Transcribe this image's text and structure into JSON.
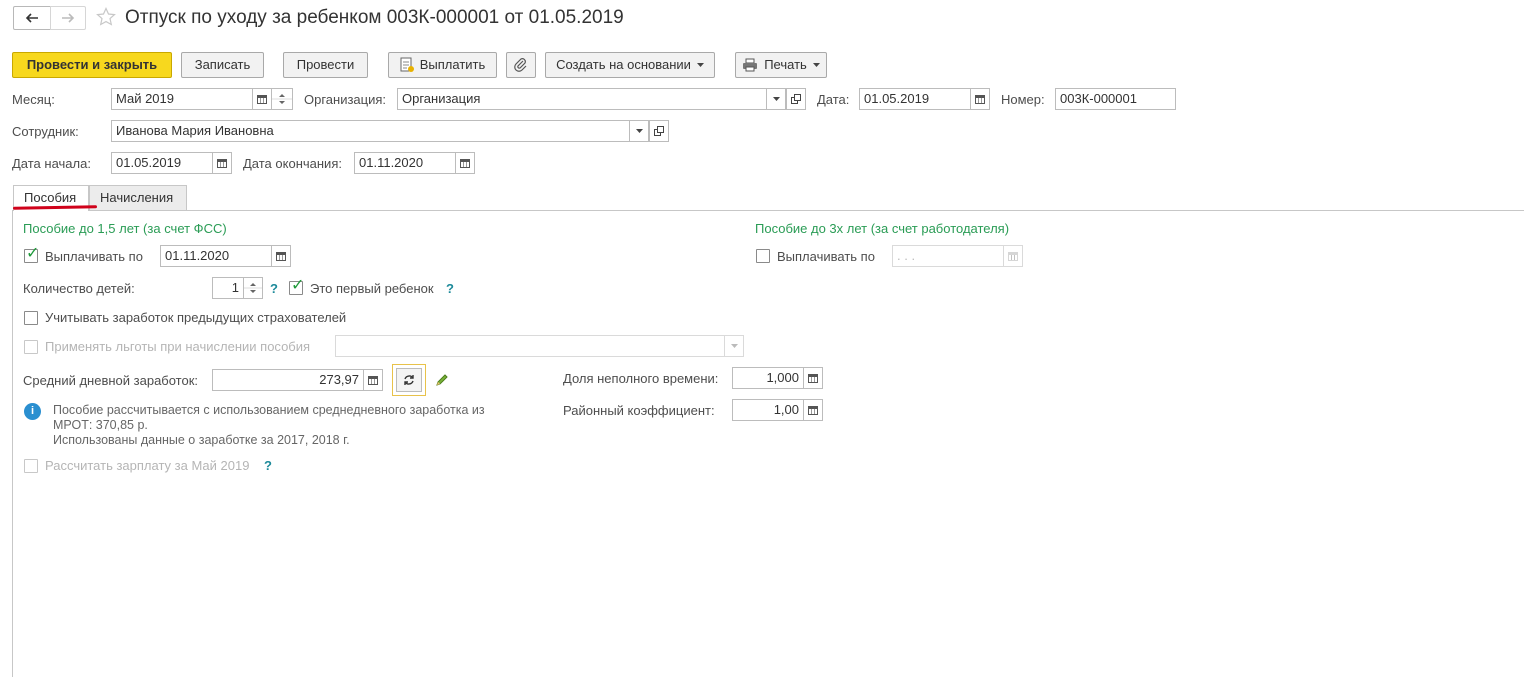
{
  "window": {
    "title": "Отпуск по уходу за ребенком 003К-000001 от 01.05.2019"
  },
  "toolbar": {
    "post_close": "Провести и закрыть",
    "save": "Записать",
    "post": "Провести",
    "pay": "Выплатить",
    "create_based": "Создать на основании",
    "print": "Печать"
  },
  "header": {
    "month_label": "Месяц:",
    "month_value": "Май 2019",
    "org_label": "Организация:",
    "org_value": "Организация",
    "date_label": "Дата:",
    "date_value": "01.05.2019",
    "number_label": "Номер:",
    "number_value": "003К-000001",
    "employee_label": "Сотрудник:",
    "employee_value": "Иванова Мария Ивановна",
    "start_label": "Дата начала:",
    "start_value": "01.05.2019",
    "end_label": "Дата окончания:",
    "end_value": "01.11.2020"
  },
  "tabs": [
    {
      "label": "Пособия",
      "active": true
    },
    {
      "label": "Начисления",
      "active": false
    }
  ],
  "benefits": {
    "fss_title": "Пособие до 1,5 лет (за счет ФСС)",
    "employer_title": "Пособие до 3х лет (за счет работодателя)",
    "pay_until_label": "Выплачивать по",
    "pay_until_value": "01.11.2020",
    "pay_until_checked": true,
    "employer_pay_until_label": "Выплачивать по",
    "employer_pay_until_value": ". . .",
    "employer_pay_until_checked": false,
    "children_label": "Количество детей:",
    "children_value": "1",
    "help_mark": "?",
    "first_child_label": "Это первый ребенок",
    "first_child_checked": true,
    "prev_insurers_label": "Учитывать заработок предыдущих страхователей",
    "apply_benefits_label": "Применять льготы при начислении пособия",
    "avg_earnings_label": "Средний дневной заработок:",
    "avg_earnings_value": "273,97",
    "part_time_label": "Доля неполного времени:",
    "part_time_value": "1,000",
    "regional_coef_label": "Районный коэффициент:",
    "regional_coef_value": "1,00",
    "info_line1": "Пособие рассчитывается с использованием среднедневного заработка из",
    "info_line2": "МРОТ: 370,85 р.",
    "info_line3": "Использованы данные о заработке за  2017,  2018 г.",
    "calc_salary_label": "Рассчитать зарплату за Май 2019"
  },
  "colors": {
    "primary_button": "#f7d81e",
    "section_title": "#2a9c55",
    "check_mark": "#1f9a3a",
    "tab_underline": "#d0021b",
    "info_icon": "#2a8fd0"
  }
}
